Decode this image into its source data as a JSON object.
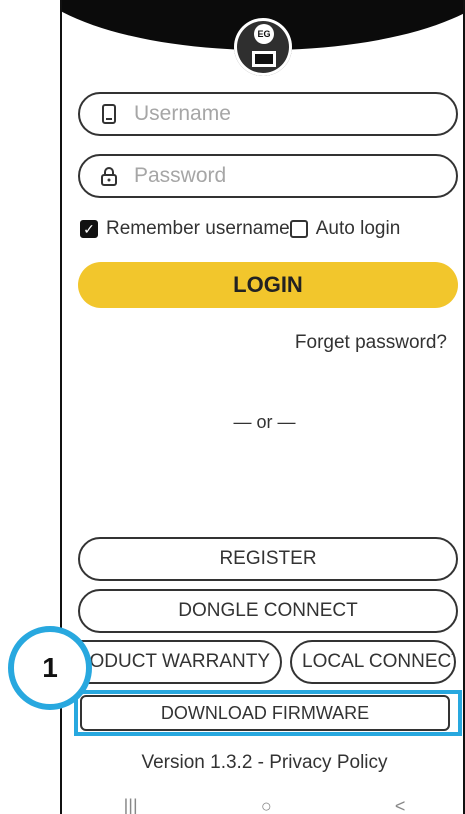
{
  "inputs": {
    "username_placeholder": "Username",
    "password_placeholder": "Password"
  },
  "remember_username": {
    "label": "Remember username",
    "checked": true
  },
  "auto_login": {
    "label": "Auto login",
    "checked": false
  },
  "buttons": {
    "login": "LOGIN",
    "register": "REGISTER",
    "dongle_connect": "DONGLE CONNECT",
    "product_warranty": "PRODUCT WARRANTY",
    "local_connect": "LOCAL CONNECT",
    "download_firmware": "DOWNLOAD FIRMWARE"
  },
  "links": {
    "forgot_password": "Forget password?"
  },
  "divider_text": "— or —",
  "footer": {
    "version": "Version 1.3.2 - Privacy Policy"
  },
  "annotation": {
    "number": "1",
    "color": "#28a8df"
  },
  "colors": {
    "login_bg": "#f2c62c",
    "header_bg": "#0b0b0b"
  },
  "icons": {
    "username": "phone-icon",
    "password": "lock-icon",
    "logo": "app-logo-icon"
  },
  "logo": {
    "badge_text": "EG"
  }
}
